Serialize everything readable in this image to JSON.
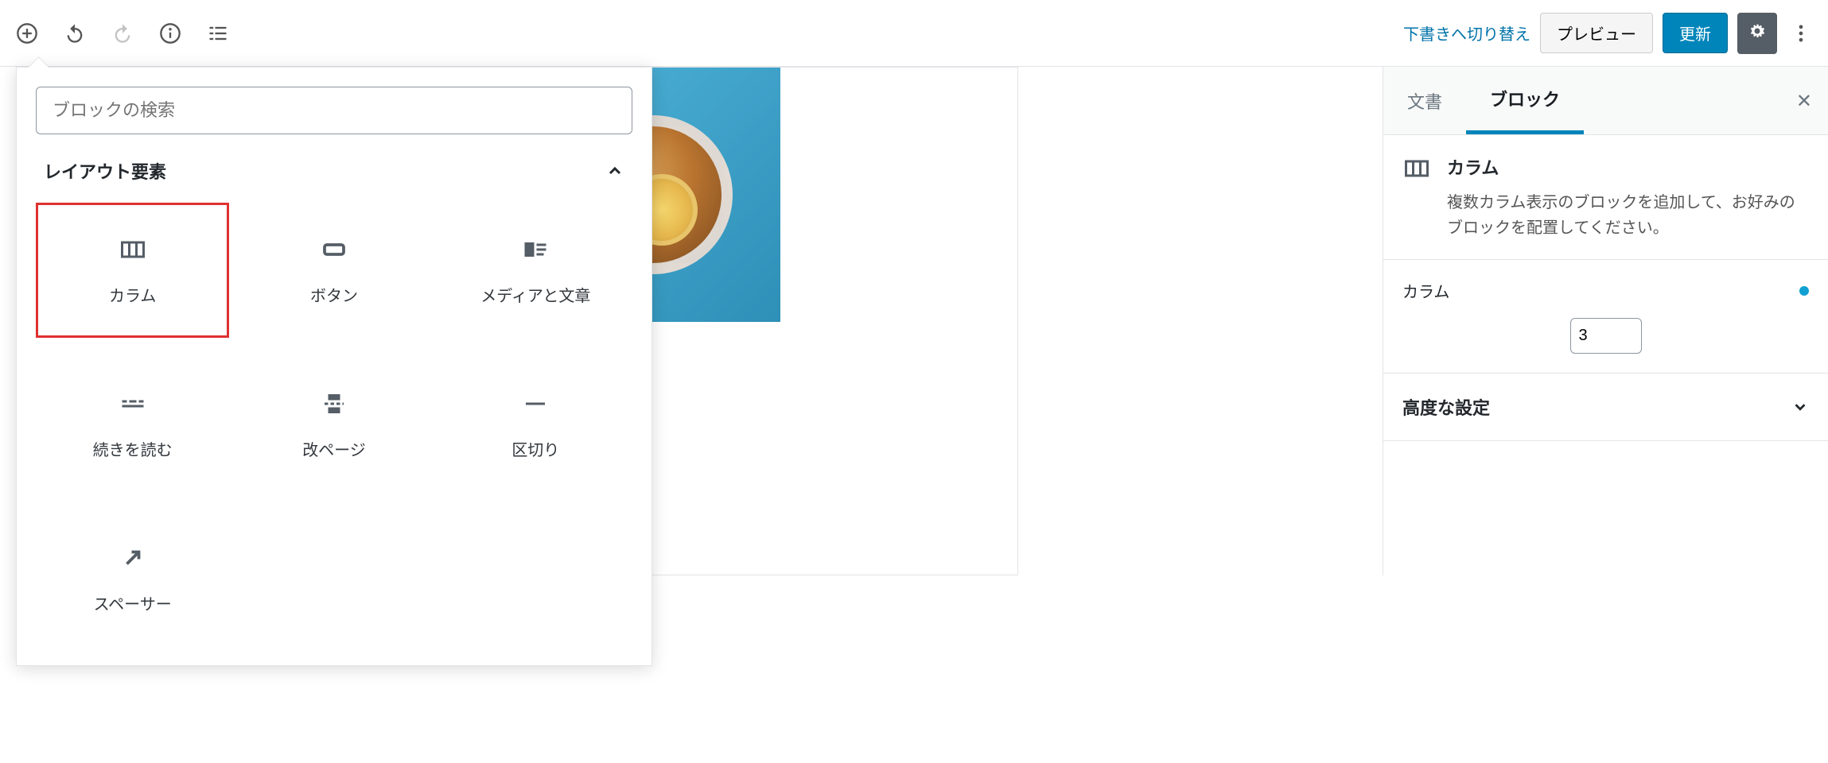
{
  "toolbar": {
    "switch_draft": "下書きへ切り替え",
    "preview": "プレビュー",
    "update": "更新"
  },
  "inserter": {
    "search_placeholder": "ブロックの検索",
    "category": "レイアウト要素",
    "blocks": {
      "columns": "カラム",
      "button": "ボタン",
      "media_text": "メディアと文章",
      "more": "続きを読む",
      "page_break": "改ページ",
      "separator": "区切り",
      "spacer": "スペーサー"
    }
  },
  "sidebar": {
    "tab_document": "文書",
    "tab_block": "ブロック",
    "block_title": "カラム",
    "block_desc": "複数カラム表示のブロックを追加して、お好みのブロックを配置してください。",
    "columns_label": "カラム",
    "columns_value": "3",
    "advanced": "高度な設定"
  }
}
